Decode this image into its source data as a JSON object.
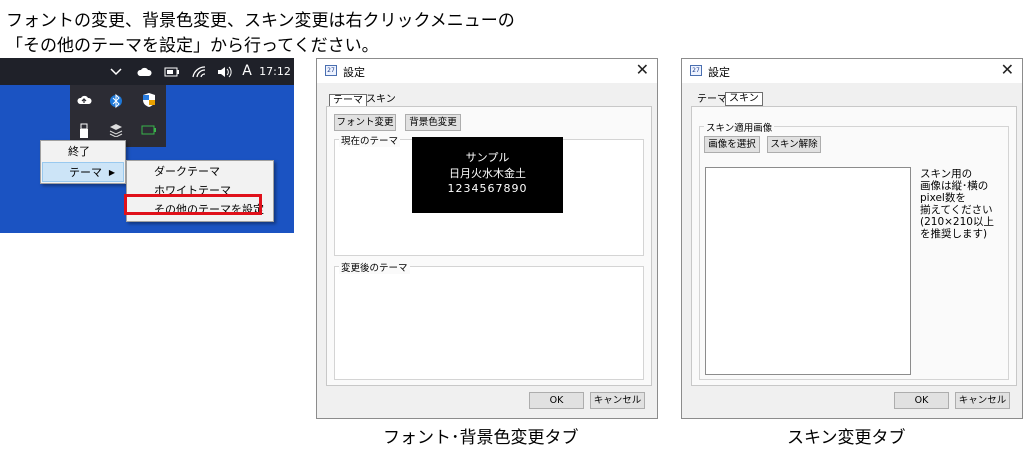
{
  "header": {
    "line1": "フォントの変更、背景色変更、スキン変更は右クリックメニューの",
    "line2": "「その他のテーマを設定」から行ってください。"
  },
  "taskbar": {
    "chevron_icon": "chevron-up",
    "time": "17:12",
    "ime_indicator": "A",
    "tray_icons": [
      "cloud-icon",
      "battery-icon",
      "wifi-icon",
      "speaker-icon"
    ],
    "popup_icons": [
      "cloud-upload-icon",
      "bluetooth-icon",
      "shield-icon",
      "usb-icon",
      "app-icon",
      "battery-green-icon"
    ]
  },
  "context_menu": {
    "items": [
      "終了",
      "テーマ"
    ],
    "submenu": [
      "ダークテーマ",
      "ホワイトテーマ",
      "その他のテーマを設定"
    ]
  },
  "dialog_font": {
    "title": "設定",
    "tabs": [
      "テーマ",
      "スキン"
    ],
    "font_button": "フォント変更",
    "bg_button": "背景色変更",
    "current_group": "現在のテーマ",
    "preview": {
      "line1": "サンプル",
      "line2": "日月火水木金土",
      "line3": "1234567890"
    },
    "after_group": "変更後のテーマ",
    "ok": "OK",
    "cancel": "キャンセル"
  },
  "dialog_skin": {
    "title": "設定",
    "tabs": [
      "テーマ",
      "スキン"
    ],
    "group": "スキン適用画像",
    "select_button": "画像を選択",
    "release_button": "スキン解除",
    "note": [
      "スキン用の",
      "画像は縦･横の",
      "pixel数を",
      "揃えてください",
      "(210×210以上",
      "を推奨します)"
    ],
    "ok": "OK",
    "cancel": "キャンセル"
  },
  "captions": {
    "font_tab": "フォント･背景色変更タブ",
    "skin_tab": "スキン変更タブ"
  },
  "colors": {
    "desktop": "#1b53c2",
    "taskbar": "#1f2129",
    "highlight_box": "#e0101a",
    "preview_bg": "#000000"
  }
}
